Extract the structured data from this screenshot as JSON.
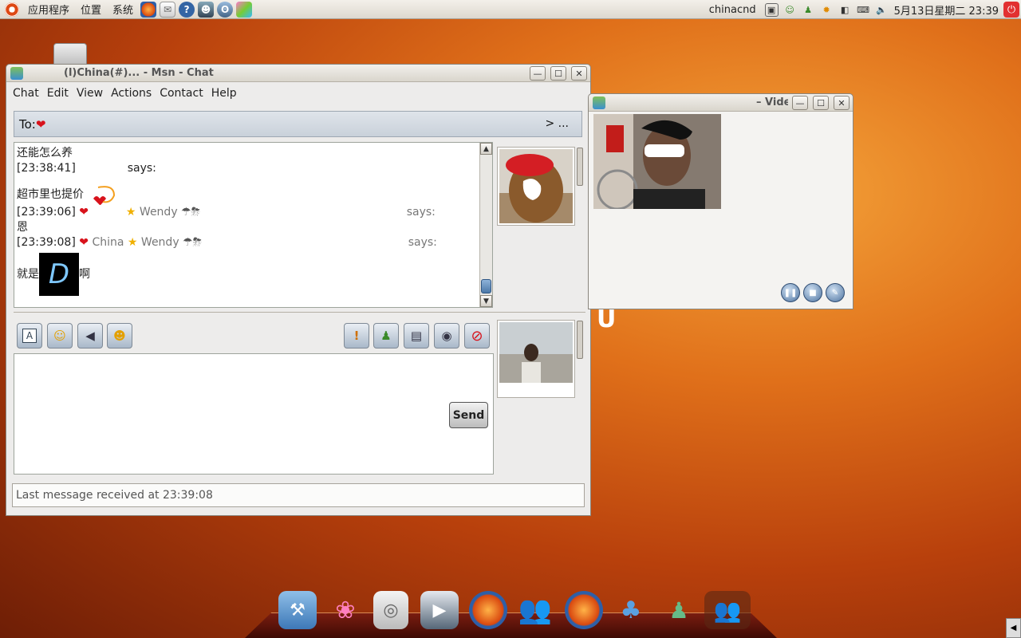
{
  "top_panel": {
    "menus": [
      "应用程序",
      "位置",
      "系统"
    ],
    "launchers": [
      "firefox-icon",
      "mail-icon",
      "help-icon",
      "pidgin-icon",
      "amsn-icon",
      "photo-icon"
    ],
    "username": "chinacnd",
    "clock": "5月13日星期二  23:39",
    "tray": [
      "sim-icon",
      "buddy-icon",
      "user-icon",
      "settings-icon",
      "network-icon",
      "keyboard-icon",
      "volume-icon"
    ]
  },
  "chat_window": {
    "title": "(l)China(#)... - Msn - Chat",
    "menu": [
      "Chat",
      "Edit",
      "View",
      "Actions",
      "Contact",
      "Help"
    ],
    "to_label": "To:",
    "to_ellipsis": "> ...",
    "history": [
      {
        "type": "text",
        "text": "还能怎么养"
      },
      {
        "type": "header",
        "time": "[23:38:41]",
        "says": "says:"
      },
      {
        "type": "text",
        "text": "超市里也提价"
      },
      {
        "type": "header",
        "time": "[23:39:06]",
        "name": "Wendy",
        "says": "says:"
      },
      {
        "type": "text",
        "text": "恩"
      },
      {
        "type": "header",
        "time": "[23:39:08]",
        "name": "China",
        "name2": "Wendy",
        "says": "says:"
      },
      {
        "type": "text",
        "prefix": "就是",
        "suffix": "啊"
      }
    ],
    "send_label": "Send",
    "status": "Last message received at 23:39:08"
  },
  "video_window": {
    "title": "– Video"
  },
  "dock": [
    "terminal-tools-icon",
    "photo-fan-icon",
    "disk-icon",
    "media-player-icon",
    "firefox-icon",
    "buddy-chat-icon",
    "firefox-icon",
    "msn-icon",
    "contacts-icon",
    "amsn-icon"
  ],
  "colors": {
    "desktop_accent": "#e0701a",
    "heart": "#d8121b",
    "button_blue": "#4c78a8"
  }
}
